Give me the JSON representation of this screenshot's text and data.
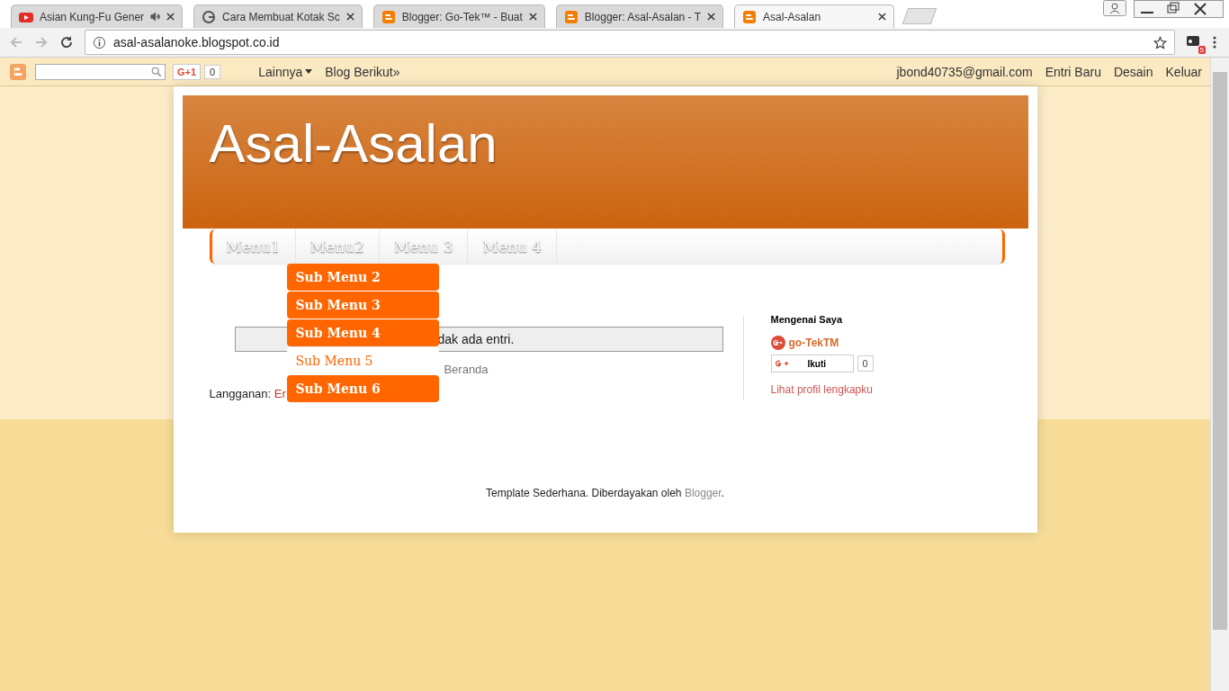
{
  "browser": {
    "tabs": [
      {
        "title": "Asian Kung-Fu Gener",
        "audio": true,
        "selected": false
      },
      {
        "title": "Cara Membuat Kotak Sc",
        "audio": false,
        "selected": false
      },
      {
        "title": "Blogger: Go-Tek™ - Buat",
        "audio": false,
        "selected": false
      },
      {
        "title": "Blogger: Asal-Asalan - T",
        "audio": false,
        "selected": false
      },
      {
        "title": "Asal-Asalan",
        "audio": false,
        "selected": true
      }
    ],
    "url": "asal-asalanoke.blogspot.co.id",
    "extension_badge": "5"
  },
  "navbar": {
    "plus_label": "G+1",
    "plus_count": "0",
    "links_left": [
      "Lainnya",
      "Blog Berikut»"
    ],
    "links_right": [
      "jbond40735@gmail.com",
      "Entri Baru",
      "Desain",
      "Keluar"
    ]
  },
  "blog": {
    "title": "Asal-Asalan",
    "menu": [
      {
        "label": "Menu1"
      },
      {
        "label": "Menu2"
      },
      {
        "label": "Menu 3"
      },
      {
        "label": "Menu 4"
      }
    ],
    "submenu": [
      {
        "label": "Sub Menu 2",
        "highlighted": false
      },
      {
        "label": "Sub Menu 3",
        "highlighted": false
      },
      {
        "label": "Sub Menu 4",
        "highlighted": false
      },
      {
        "label": "Sub Menu 5",
        "highlighted": true
      },
      {
        "label": "Sub Menu 6",
        "highlighted": false
      }
    ],
    "no_posts": "dak ada entri.",
    "home_link": "Beranda",
    "subscribe_label": "Langganan:",
    "subscribe_link": "Er",
    "sidebar": {
      "heading": "Mengenai Saya",
      "profile_name": "go-TekTM",
      "follow_label": "Ikuti",
      "follow_count": "0",
      "profile_link": "Lihat profil lengkapku"
    },
    "footer_text": "Template Sederhana. Diberdayakan oleh ",
    "footer_link": "Blogger",
    "footer_end": "."
  }
}
